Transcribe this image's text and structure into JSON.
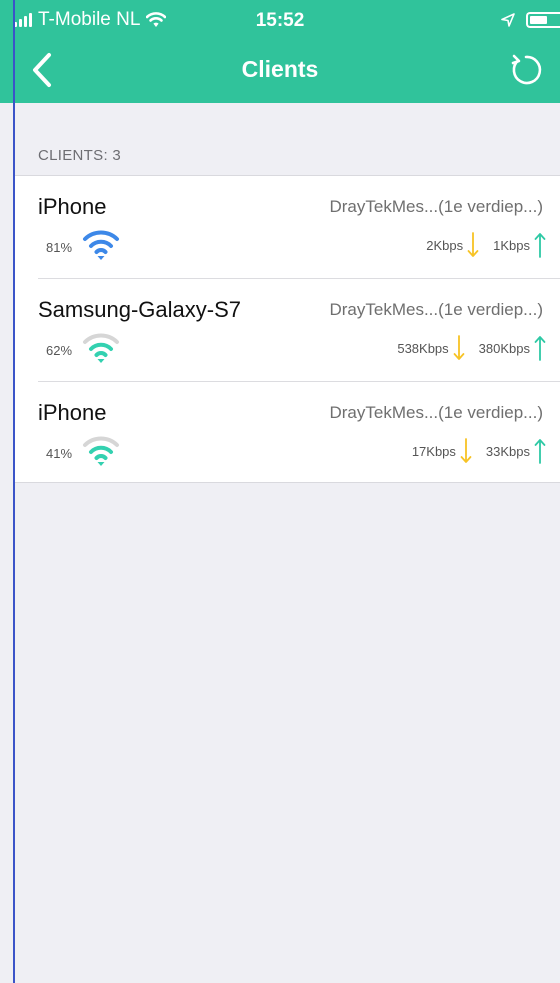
{
  "status_bar": {
    "carrier": "T-Mobile NL",
    "time": "15:52"
  },
  "nav": {
    "title": "Clients"
  },
  "section": {
    "header": "CLIENTS: 3"
  },
  "clients": [
    {
      "name": "iPhone",
      "network": "DrayTekMes...(1e verdiep...)",
      "signal": "81%",
      "signal_level": 0.81,
      "wifi_color": "#3d88e8",
      "down_rate": "2Kbps",
      "up_rate": "1Kbps"
    },
    {
      "name": "Samsung-Galaxy-S7",
      "network": "DrayTekMes...(1e verdiep...)",
      "signal": "62%",
      "signal_level": 0.62,
      "wifi_color": "#33d1b0",
      "down_rate": "538Kbps",
      "up_rate": "380Kbps"
    },
    {
      "name": "iPhone",
      "network": "DrayTekMes...(1e verdiep...)",
      "signal": "41%",
      "signal_level": 0.41,
      "wifi_color": "#33d1b0",
      "down_rate": "17Kbps",
      "up_rate": "33Kbps"
    }
  ],
  "colors": {
    "header_bg": "#30c39b",
    "download_arrow": "#f7c325",
    "upload_arrow": "#2ec9a5",
    "wifi_inactive": "#d6d6d6"
  },
  "icons": {
    "back": "chevron-left-icon",
    "refresh": "refresh-icon",
    "wifi": "wifi-icon",
    "download": "arrow-down-icon",
    "upload": "arrow-up-icon",
    "battery": "battery-icon",
    "location": "location-arrow-icon"
  }
}
